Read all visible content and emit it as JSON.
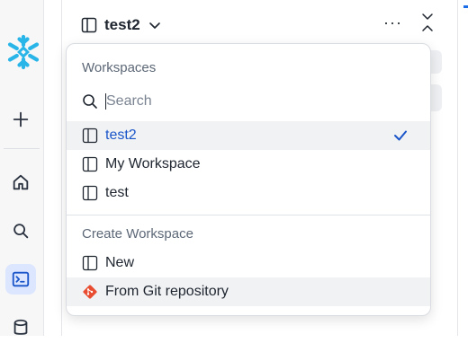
{
  "header": {
    "workspace_name": "test2",
    "more_icon_text": "···"
  },
  "dropdown": {
    "workspaces_title": "Workspaces",
    "search_placeholder": "Search",
    "workspaces": [
      {
        "label": "test2",
        "selected": true
      },
      {
        "label": "My Workspace",
        "selected": false
      },
      {
        "label": "test",
        "selected": false
      }
    ],
    "create_title": "Create Workspace",
    "create_items": [
      {
        "label": "New",
        "icon": "workspace-icon"
      },
      {
        "label": "From Git repository",
        "icon": "git-icon"
      }
    ]
  },
  "rail": {
    "items": [
      "plus-icon",
      "home-icon",
      "search-icon",
      "terminal-icon",
      "database-icon"
    ],
    "active": "terminal-icon"
  },
  "colors": {
    "brand_logo": "#29b5e8",
    "accent": "#1a55c9",
    "git": "#e84d31"
  }
}
